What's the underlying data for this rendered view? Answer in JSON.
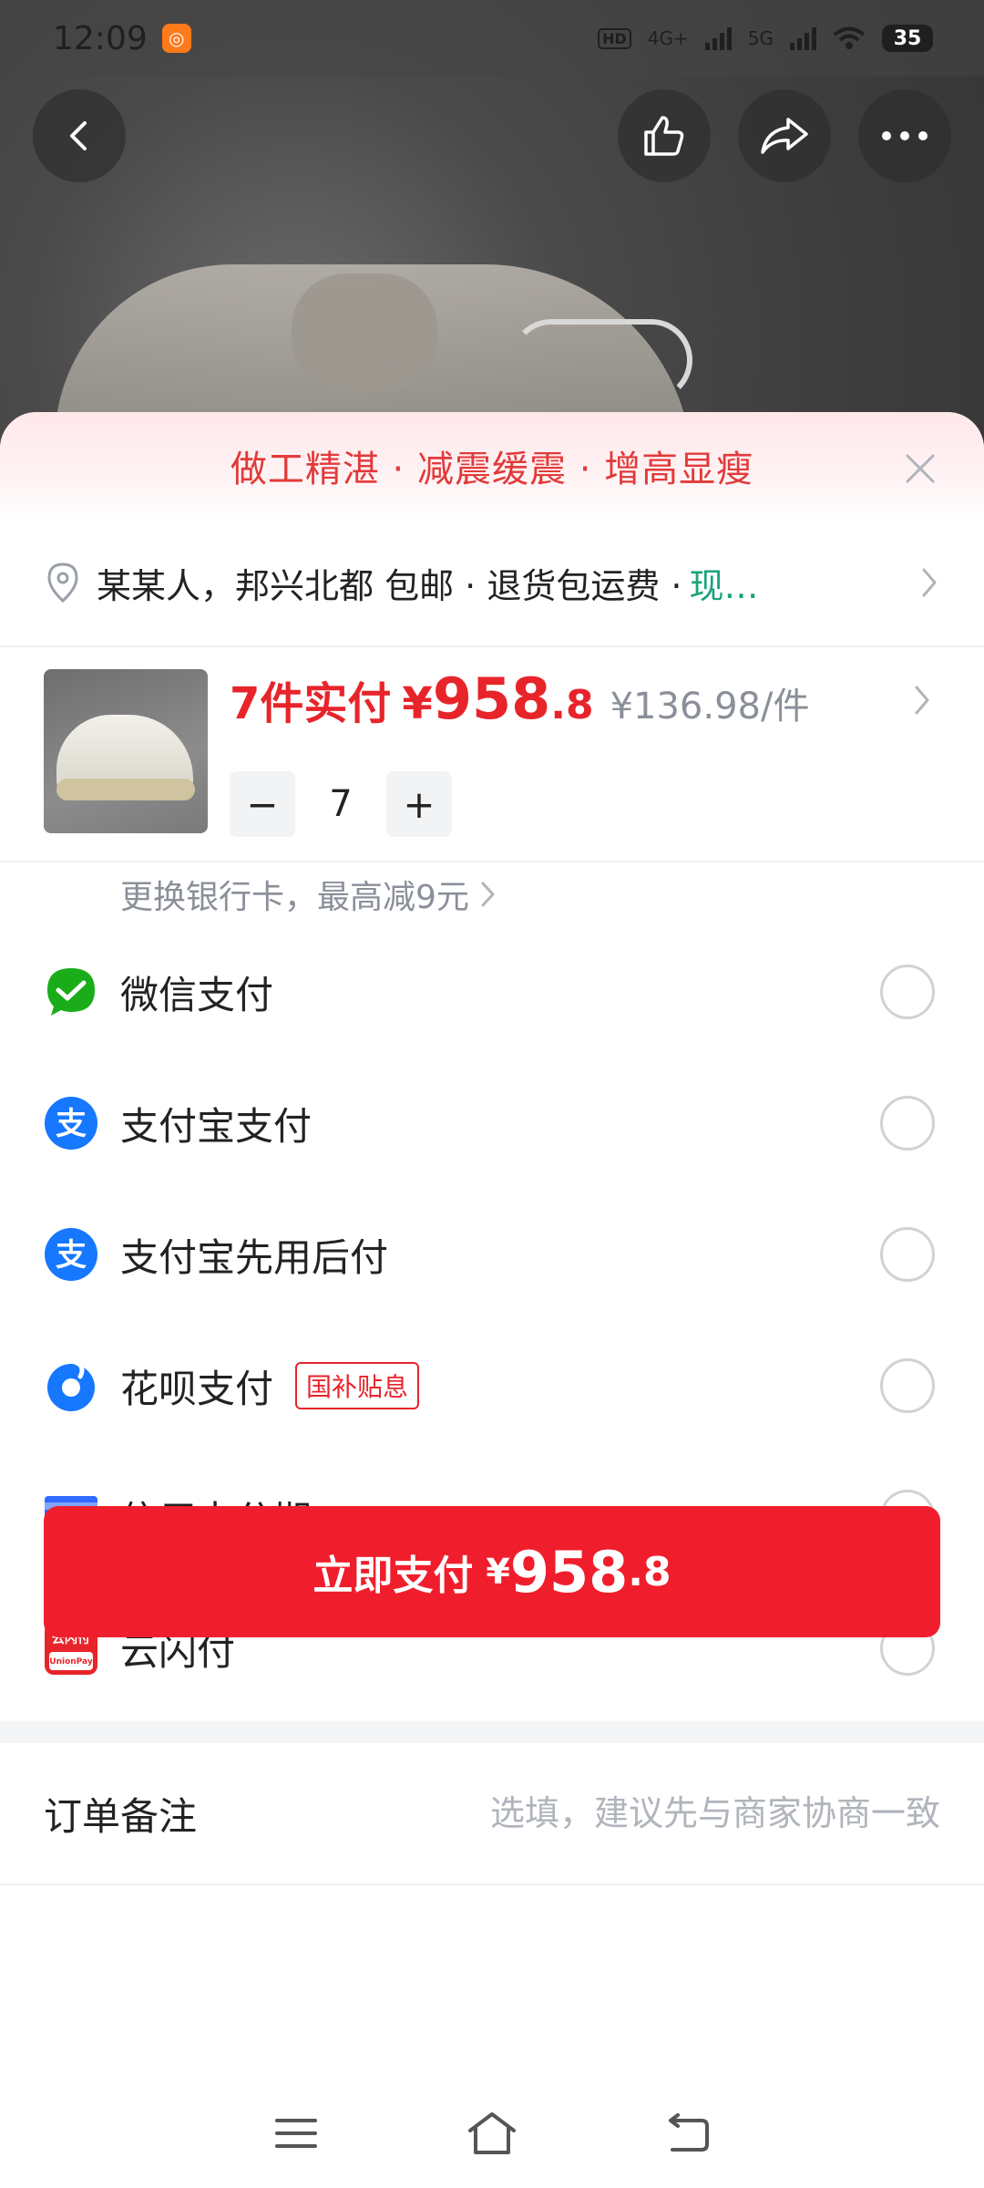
{
  "status_bar": {
    "time": "12:09",
    "hd_label": "HD",
    "network1": "4G+",
    "network2": "5G",
    "battery": "35"
  },
  "top_actions": {
    "back_icon": "back-arrow-icon",
    "like_icon": "thumbs-up-icon",
    "share_icon": "share-icon",
    "more_icon": "more-dots-icon"
  },
  "promo": {
    "text": "做工精湛 · 减震缓震 · 增高显瘦"
  },
  "address": {
    "text": "某某人，邦兴北都  包邮  ·  退货包运费  ·",
    "highlight": "现…"
  },
  "product": {
    "count_label": "7件实付",
    "currency": "¥",
    "price_int": "958",
    "price_dec": ".8",
    "unit_price": "¥136.98/件",
    "quantity": "7",
    "minus": "−",
    "plus": "+"
  },
  "bank_hint": "更换银行卡，最高减9元",
  "payment_methods": [
    {
      "label": "微信支付",
      "icon": "wechat-pay-icon",
      "tag": ""
    },
    {
      "label": "支付宝支付",
      "icon": "alipay-icon",
      "tag": ""
    },
    {
      "label": "支付宝先用后付",
      "icon": "alipay-icon",
      "tag": ""
    },
    {
      "label": "花呗支付",
      "icon": "huabei-icon",
      "tag": "国补贴息"
    },
    {
      "label": "信用卡分期",
      "icon": "credit-card-installment-icon",
      "tag": ""
    },
    {
      "label": "云闪付",
      "icon": "unionpay-icon",
      "tag": ""
    }
  ],
  "icon_texts": {
    "installment": "分期",
    "unionpay_cn": "云闪付",
    "unionpay_en": "UnionPay"
  },
  "order_note": {
    "label": "订单备注",
    "placeholder": "选填，建议先与商家协商一致"
  },
  "pay_button": {
    "label": "立即支付",
    "currency": "¥",
    "price_int": "958",
    "price_dec": ".8"
  },
  "colors": {
    "accent_red": "#f01e2c",
    "price_red": "#e8242b",
    "green": "#1aa37a",
    "wechat_green": "#1aad19",
    "alipay_blue": "#1677ff"
  }
}
